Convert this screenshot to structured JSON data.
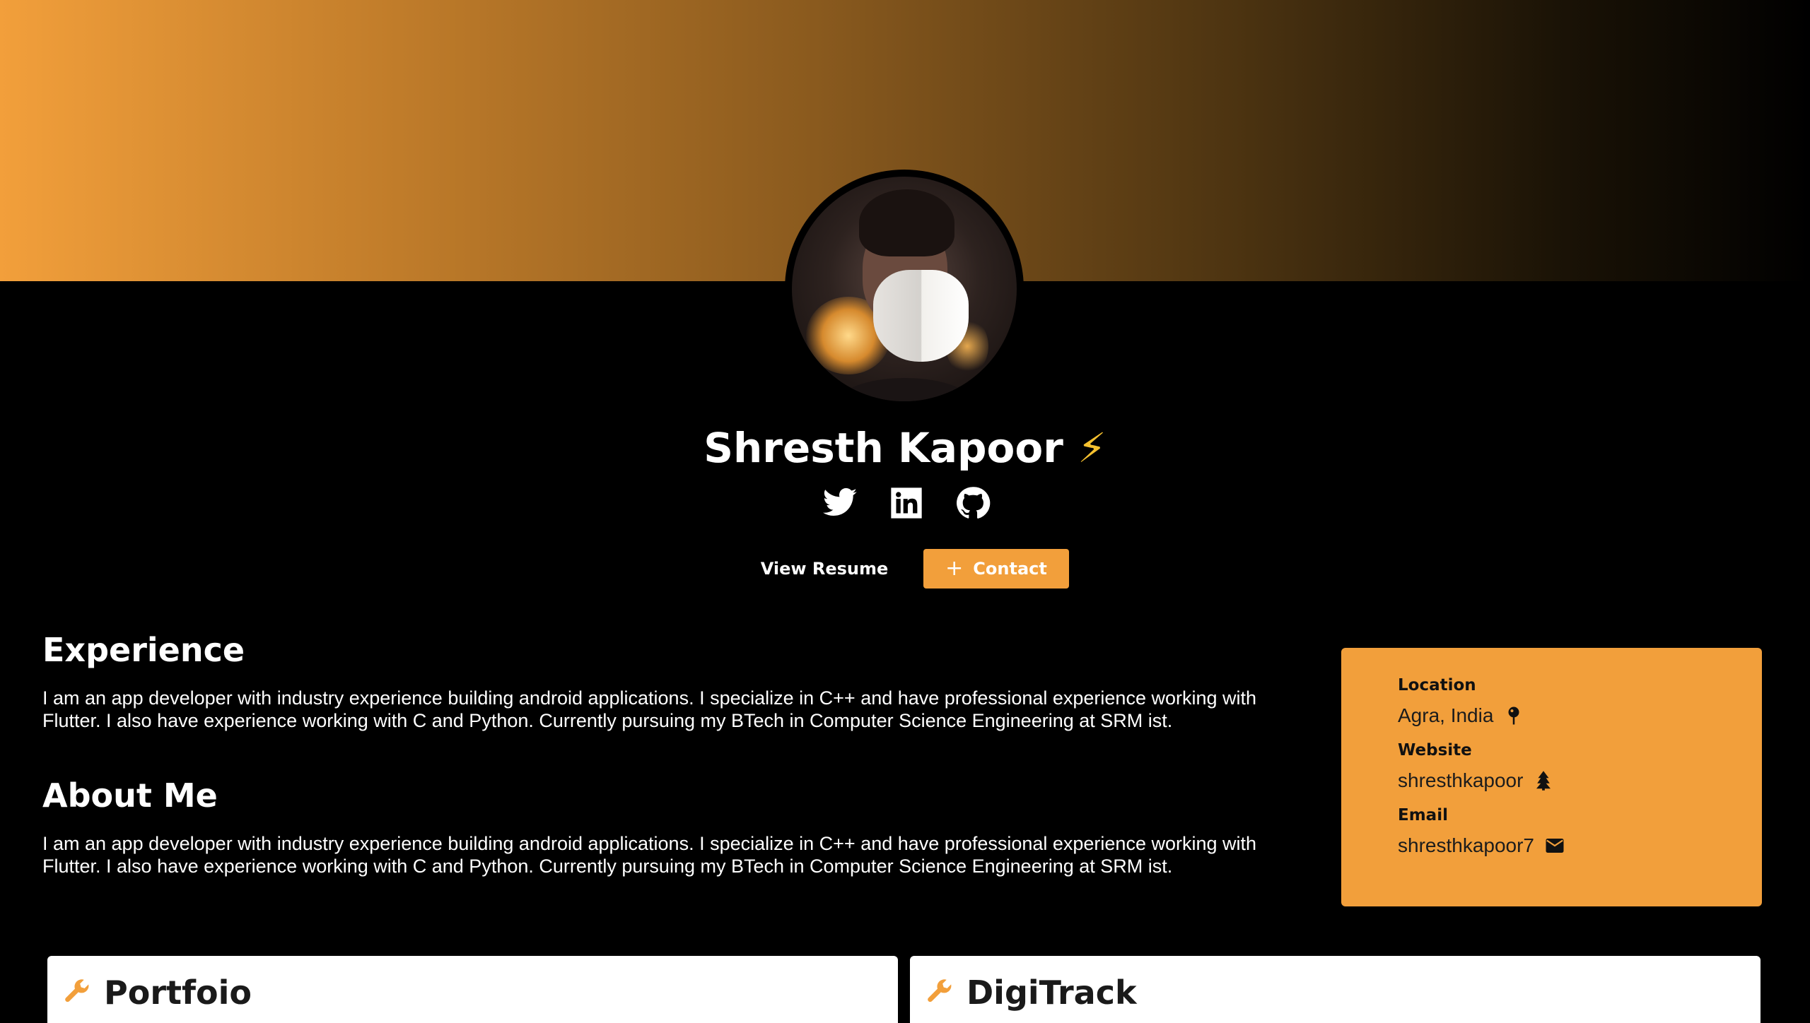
{
  "profile": {
    "name": "Shresth Kapoor",
    "emoji": "⚡",
    "socials": [
      "twitter-icon",
      "linkedin-icon",
      "github-icon"
    ]
  },
  "actions": {
    "resume_label": "View Resume",
    "contact_label": "Contact"
  },
  "experience": {
    "title": "Experience",
    "text": "I am an app developer with industry experience building android applications. I specialize in C++ and have professional experience working with Flutter. I also have experience working with C and Python. Currently pursuing my BTech in Computer Science Engineering at SRM ist."
  },
  "about": {
    "title": "About Me",
    "text": "I am an app developer with industry experience building android applications. I specialize in C++ and have professional experience working with Flutter. I also have experience working with C and Python. Currently pursuing my BTech in Computer Science Engineering at SRM ist."
  },
  "info": {
    "location_label": "Location",
    "location_value": "Agra, India",
    "website_label": "Website",
    "website_value": "shresthkapoor",
    "email_label": "Email",
    "email_value": "shresthkapoor7"
  },
  "projects": [
    {
      "title": "Portfoio",
      "icon": "wrench-icon"
    },
    {
      "title": "DigiTrack",
      "icon": "wrench-icon"
    }
  ],
  "colors": {
    "accent": "#f29f3b",
    "background": "#000000",
    "card": "#ffffff"
  }
}
